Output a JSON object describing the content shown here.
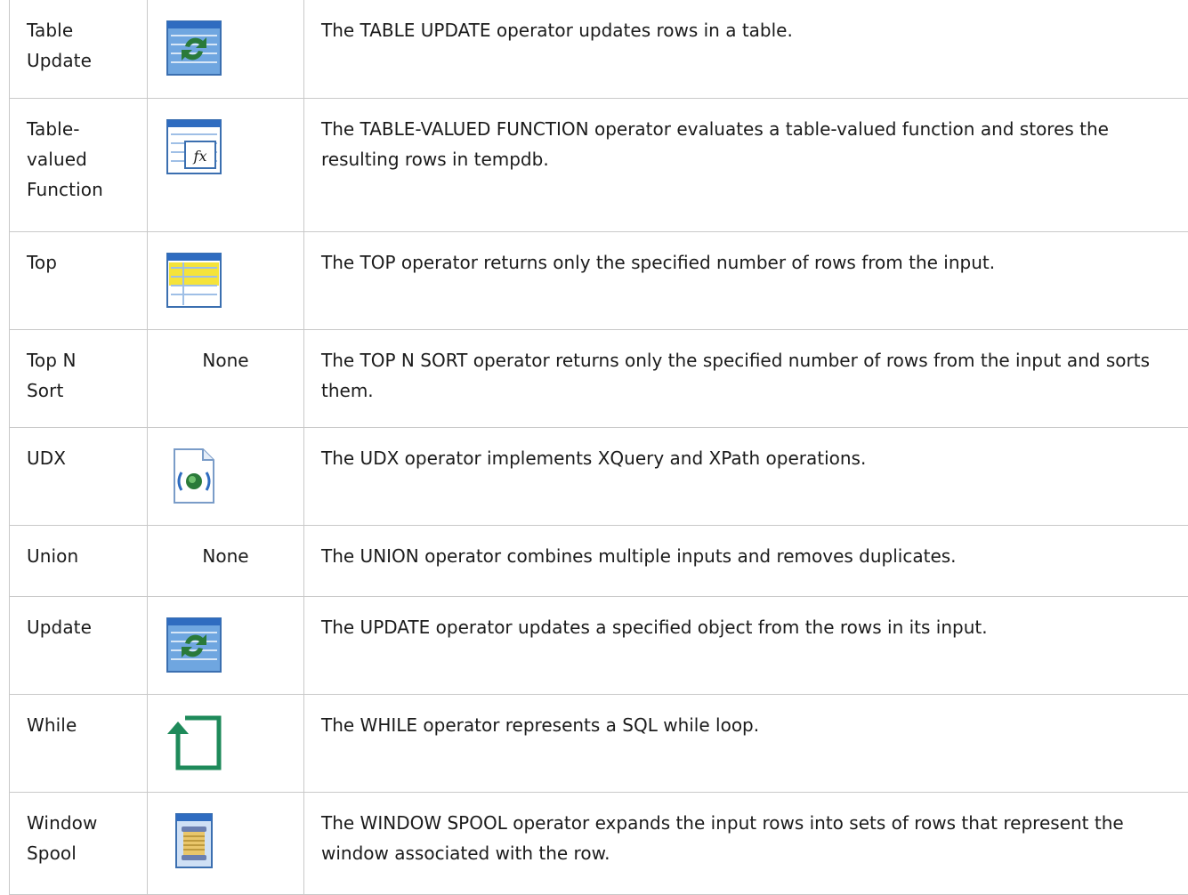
{
  "rows": [
    {
      "name": "Table\nUpdate",
      "icon": "table-update-icon",
      "icon_text": "",
      "description": "The TABLE UPDATE operator updates rows in a table."
    },
    {
      "name": "Table-\nvalued\nFunction",
      "icon": "table-valued-function-icon",
      "icon_text": "",
      "description": "The TABLE-VALUED FUNCTION operator evaluates a table-valued function and stores the resulting rows in tempdb."
    },
    {
      "name": "Top",
      "icon": "top-icon",
      "icon_text": "",
      "description": "The TOP operator returns only the specified number of rows from the input."
    },
    {
      "name": "Top N\nSort",
      "icon": "",
      "icon_text": "None",
      "description": "The TOP N SORT operator returns only the specified number of rows from the input and sorts them."
    },
    {
      "name": "UDX",
      "icon": "udx-icon",
      "icon_text": "",
      "description": "The UDX operator implements XQuery and XPath operations."
    },
    {
      "name": "Union",
      "icon": "",
      "icon_text": "None",
      "description": "The UNION operator combines multiple inputs and removes duplicates."
    },
    {
      "name": "Update",
      "icon": "update-icon",
      "icon_text": "",
      "description": "The UPDATE operator updates a specified object from the rows in its input."
    },
    {
      "name": "While",
      "icon": "while-loop-icon",
      "icon_text": "",
      "description": "The WHILE operator represents a SQL while loop."
    },
    {
      "name": "Window\nSpool",
      "icon": "window-spool-icon",
      "icon_text": "",
      "description": "The WINDOW SPOOL operator expands the input rows into sets of rows that represent the window associated with the row."
    }
  ],
  "colors": {
    "border": "#c9c9c9",
    "text": "#1b1b1b",
    "icon_blue": "#4a8bd4",
    "icon_yellow": "#f5e33a",
    "icon_green": "#1e8a5a"
  }
}
